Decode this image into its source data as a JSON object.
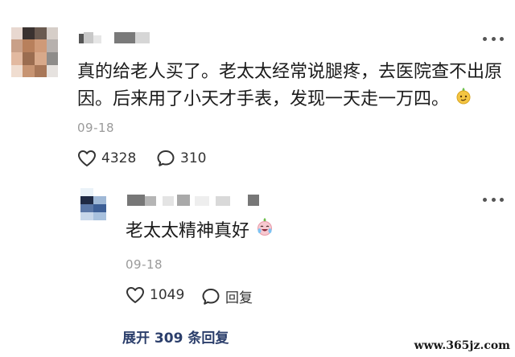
{
  "comment": {
    "text_line1": "真的给老人买了。老太太经常说腿疼，去医院查不出原",
    "text_line2": "因。后来用了小天才手表，发现一天走一万四。",
    "emoji": "smirk-emoji",
    "time": "09-18",
    "likes": "4328",
    "replies": "310"
  },
  "reply": {
    "text": "老太太精神真好",
    "emoji": "crying-laughing-emoji",
    "time": "09-18",
    "likes": "1049",
    "reply_label": "回复"
  },
  "expand_label": "展开 309 条回复",
  "watermark": "www.365jz.com",
  "colors": {
    "link": "#2b3e6b",
    "muted": "#9a9a9a"
  }
}
